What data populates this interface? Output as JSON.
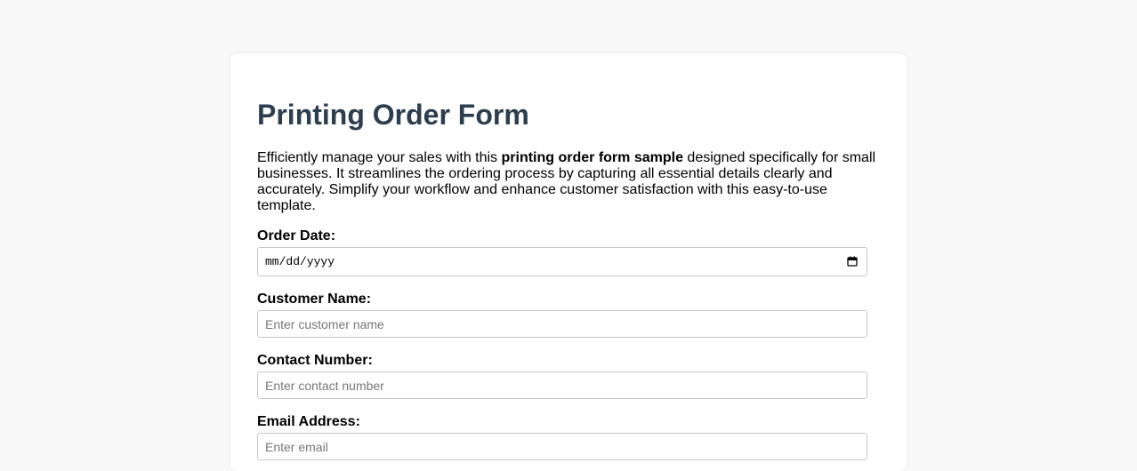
{
  "form": {
    "title": "Printing Order Form",
    "intro": {
      "before": "Efficiently manage your sales with this ",
      "bold": "printing order form sample",
      "after": " designed specifically for small businesses. It streamlines the ordering process by capturing all essential details clearly and accurately. Simplify your workflow and enhance customer satisfaction with this easy-to-use template."
    },
    "fields": {
      "order_date": {
        "label": "Order Date:",
        "value": "mm/dd/yyyy",
        "icon": "calendar-icon"
      },
      "customer_name": {
        "label": "Customer Name:",
        "placeholder": "Enter customer name"
      },
      "contact_number": {
        "label": "Contact Number:",
        "placeholder": "Enter contact number"
      },
      "email_address": {
        "label": "Email Address:",
        "placeholder": "Enter email"
      }
    }
  },
  "colors": {
    "page_background": "#f8f8f8",
    "card_background": "#ffffff",
    "title": "#2c3e50",
    "input_border": "#c8c8c8"
  }
}
